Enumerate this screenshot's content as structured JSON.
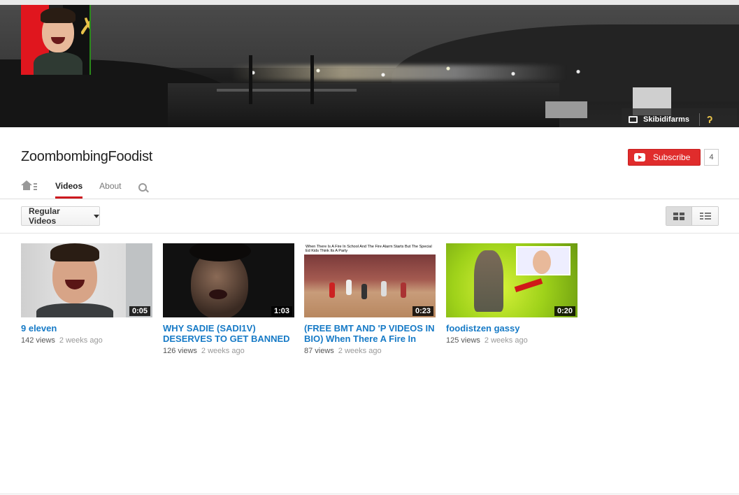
{
  "channel": {
    "name": "ZoombombingFoodist",
    "subscribe_label": "Subscribe",
    "subscriber_count": "4",
    "banner_link_label": "Skibidifarms"
  },
  "tabs": [
    {
      "label": "Videos",
      "active": true
    },
    {
      "label": "About",
      "active": false
    }
  ],
  "filter": {
    "selected": "Regular Videos"
  },
  "videos": [
    {
      "title": "9 eleven",
      "duration": "0:05",
      "views": "142 views",
      "ago": "2 weeks ago"
    },
    {
      "title": "WHY SADIE (SADI1V) DESERVES TO GET BANNED",
      "duration": "1:03",
      "views": "126 views",
      "ago": "2 weeks ago"
    },
    {
      "title": "(FREE BMT AND 'P VIDEOS IN BIO) When There A Fire In",
      "duration": "0:23",
      "views": "87 views",
      "ago": "2 weeks ago",
      "thumb_caption": "When There Is A Fire In School And The Fire Alarm Starts But The Special Ed Kids Think Its A Party"
    },
    {
      "title": "foodistzen gassy",
      "duration": "0:20",
      "views": "125 views",
      "ago": "2 weeks ago"
    }
  ],
  "colors": {
    "accent_red": "#e02c2c",
    "link_blue": "#167ac6",
    "tab_underline": "#cc181e"
  },
  "icons": [
    "home-icon",
    "search-icon",
    "grid-view-icon",
    "list-view-icon",
    "youtube-logo-icon",
    "caret-down-icon",
    "monitor-icon"
  ]
}
